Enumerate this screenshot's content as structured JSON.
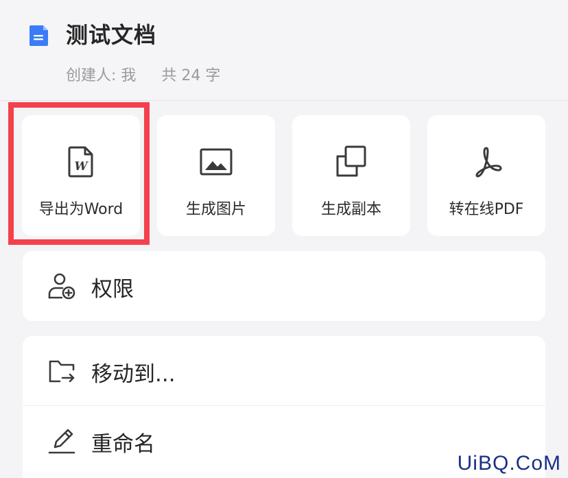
{
  "header": {
    "title": "测试文档",
    "creator": "创建人: 我",
    "word_count": "共 24 字",
    "doc_icon": "document-icon",
    "doc_icon_color": "#3a7cf6"
  },
  "actions": [
    {
      "label": "导出为Word",
      "icon": "word-file-icon"
    },
    {
      "label": "生成图片",
      "icon": "image-icon"
    },
    {
      "label": "生成副本",
      "icon": "copy-icon"
    },
    {
      "label": "转在线PDF",
      "icon": "pdf-icon"
    }
  ],
  "highlight_color": "#f3414d",
  "menu": {
    "permissions": {
      "label": "权限",
      "icon": "user-add-icon"
    },
    "move": {
      "label": "移动到...",
      "icon": "folder-move-icon"
    },
    "rename": {
      "label": "重命名",
      "icon": "pencil-icon"
    }
  },
  "watermark": "UiBQ.CoM"
}
